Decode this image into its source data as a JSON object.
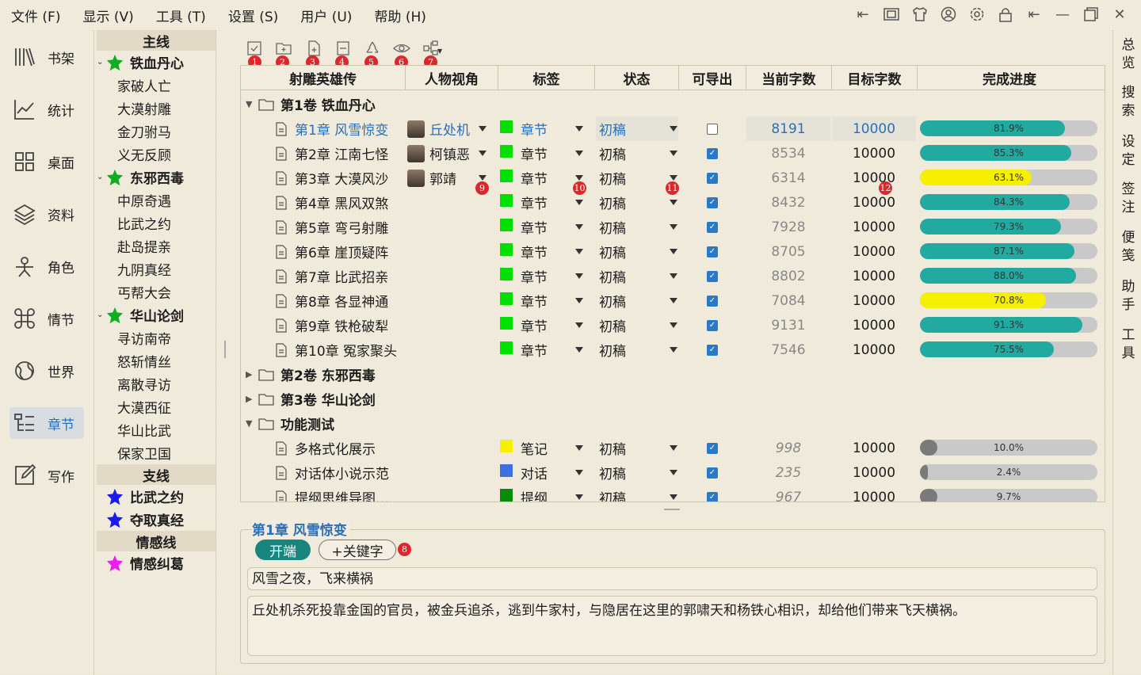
{
  "menu": [
    "文件 (F)",
    "显示 (V)",
    "工具 (T)",
    "设置 (S)",
    "用户 (U)",
    "帮助 (H)"
  ],
  "nav": {
    "bookshelf": "书架",
    "stats": "统计",
    "desktop": "桌面",
    "materials": "资料",
    "characters": "角色",
    "plot": "情节",
    "world": "世界",
    "chapters": "章节",
    "write": "写作"
  },
  "outline": {
    "main_header": "主线",
    "groups": [
      {
        "label": "铁血丹心",
        "items": [
          "家破人亡",
          "大漠射雕",
          "金刀驸马",
          "义无反顾"
        ]
      },
      {
        "label": "东邪西毒",
        "items": [
          "中原奇遇",
          "比武之约",
          "赴岛提亲",
          "九阴真经",
          "丐帮大会"
        ]
      },
      {
        "label": "华山论剑",
        "items": [
          "寻访南帝",
          "怒斩情丝",
          "离散寻访",
          "大漠西征",
          "华山比武",
          "保家卫国"
        ]
      }
    ],
    "side_header": "支线",
    "side_items": [
      "比武之约",
      "夺取真经"
    ],
    "emotion_header": "情感线",
    "emotion_items": [
      "情感纠葛"
    ]
  },
  "toolbar_badges": [
    "1",
    "2",
    "3",
    "4",
    "5",
    "6",
    "7"
  ],
  "cell_badges": [
    "9",
    "10",
    "11",
    "12"
  ],
  "table": {
    "headers": {
      "title": "射雕英雄传",
      "pov": "人物视角",
      "tag": "标签",
      "status": "状态",
      "exportable": "可导出",
      "current": "当前字数",
      "target": "目标字数",
      "progress": "完成进度"
    },
    "volumes": {
      "v1": "第1卷 铁血丹心",
      "v2": "第2卷 东邪西毒",
      "v3": "第3卷 华山论剑",
      "v4": "功能测试"
    },
    "rows": [
      {
        "title": "第1章 风雪惊变",
        "pov": "丘处机",
        "tag": "章节",
        "status": "初稿",
        "export": false,
        "current": "8191",
        "target": "10000",
        "progress": "81.9%",
        "pct": 0.819,
        "color": "#22aaa0",
        "tagcolor": "#00e000"
      },
      {
        "title": "第2章 江南七怪",
        "pov": "柯镇恶",
        "tag": "章节",
        "status": "初稿",
        "export": true,
        "current": "8534",
        "target": "10000",
        "progress": "85.3%",
        "pct": 0.853,
        "color": "#22aaa0",
        "tagcolor": "#00e000"
      },
      {
        "title": "第3章 大漠风沙",
        "pov": "郭靖",
        "tag": "章节",
        "status": "初稿",
        "export": true,
        "current": "6314",
        "target": "10000",
        "progress": "63.1%",
        "pct": 0.631,
        "color": "#f5f000",
        "tagcolor": "#00e000"
      },
      {
        "title": "第4章 黑风双煞",
        "pov": "",
        "tag": "章节",
        "status": "初稿",
        "export": true,
        "current": "8432",
        "target": "10000",
        "progress": "84.3%",
        "pct": 0.843,
        "color": "#22aaa0",
        "tagcolor": "#00e000"
      },
      {
        "title": "第5章 弯弓射雕",
        "pov": "",
        "tag": "章节",
        "status": "初稿",
        "export": true,
        "current": "7928",
        "target": "10000",
        "progress": "79.3%",
        "pct": 0.793,
        "color": "#22aaa0",
        "tagcolor": "#00e000"
      },
      {
        "title": "第6章 崖顶疑阵",
        "pov": "",
        "tag": "章节",
        "status": "初稿",
        "export": true,
        "current": "8705",
        "target": "10000",
        "progress": "87.1%",
        "pct": 0.871,
        "color": "#22aaa0",
        "tagcolor": "#00e000"
      },
      {
        "title": "第7章 比武招亲",
        "pov": "",
        "tag": "章节",
        "status": "初稿",
        "export": true,
        "current": "8802",
        "target": "10000",
        "progress": "88.0%",
        "pct": 0.88,
        "color": "#22aaa0",
        "tagcolor": "#00e000"
      },
      {
        "title": "第8章 各显神通",
        "pov": "",
        "tag": "章节",
        "status": "初稿",
        "export": true,
        "current": "7084",
        "target": "10000",
        "progress": "70.8%",
        "pct": 0.708,
        "color": "#f5f000",
        "tagcolor": "#00e000"
      },
      {
        "title": "第9章 铁枪破犁",
        "pov": "",
        "tag": "章节",
        "status": "初稿",
        "export": true,
        "current": "9131",
        "target": "10000",
        "progress": "91.3%",
        "pct": 0.913,
        "color": "#22aaa0",
        "tagcolor": "#00e000"
      },
      {
        "title": "第10章 冤家聚头",
        "pov": "",
        "tag": "章节",
        "status": "初稿",
        "export": true,
        "current": "7546",
        "target": "10000",
        "progress": "75.5%",
        "pct": 0.755,
        "color": "#22aaa0",
        "tagcolor": "#00e000"
      }
    ],
    "test_rows": [
      {
        "title": "多格式化展示",
        "tag": "笔记",
        "status": "初稿",
        "export": true,
        "current": "998",
        "target": "10000",
        "progress": "10.0%",
        "pct": 0.1,
        "color": "#7a7a7a",
        "tagcolor": "#f7f000"
      },
      {
        "title": "对话体小说示范",
        "tag": "对话",
        "status": "初稿",
        "export": true,
        "current": "235",
        "target": "10000",
        "progress": "2.4%",
        "pct": 0.024,
        "color": "#7a7a7a",
        "tagcolor": "#3f6fe0"
      },
      {
        "title": "提纲思维导图…",
        "tag": "提纲",
        "status": "初稿",
        "export": true,
        "current": "967",
        "target": "10000",
        "progress": "9.7%",
        "pct": 0.097,
        "color": "#7a7a7a",
        "tagcolor": "#0a8a0a"
      }
    ]
  },
  "editor": {
    "title": "第1章 风雪惊变",
    "stage": "开端",
    "add_keyword": "+关键字",
    "badge": "8",
    "summary": "风雪之夜，飞来横祸",
    "content": "丘处机杀死投靠金国的官员，被金兵追杀，逃到牛家村，与隐居在这里的郭啸天和杨铁心相识，却给他们带来飞天横祸。"
  },
  "rail": [
    "总览",
    "搜索",
    "设定",
    "签注",
    "便笺",
    "助手",
    "工具"
  ]
}
